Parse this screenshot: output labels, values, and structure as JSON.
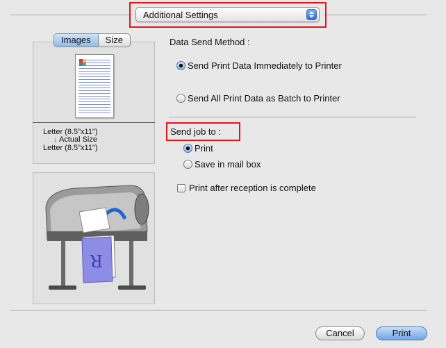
{
  "header": {
    "popup_label": "Additional Settings"
  },
  "tabs": [
    {
      "label": "Images",
      "selected": true
    },
    {
      "label": "Size",
      "selected": false
    }
  ],
  "paper_info": {
    "from": "Letter (8.5\"x11\")",
    "scale": "Actual Size",
    "to": "Letter (8.5\"x11\")"
  },
  "send_method": {
    "title": "Data Send Method :",
    "options": [
      {
        "label": "Send Print Data Immediately to Printer",
        "selected": true
      },
      {
        "label": "Send All Print Data as Batch to Printer",
        "selected": false
      }
    ]
  },
  "send_job": {
    "title": "Send job to :",
    "options": [
      {
        "label": "Print",
        "selected": true
      },
      {
        "label": "Save in mail box",
        "selected": false
      }
    ]
  },
  "after_reception": {
    "label": "Print after reception is complete",
    "checked": false
  },
  "buttons": {
    "cancel": "Cancel",
    "print": "Print"
  },
  "colors": {
    "highlight_red": "#e0151b",
    "accent_blue": "#2f70d8"
  }
}
